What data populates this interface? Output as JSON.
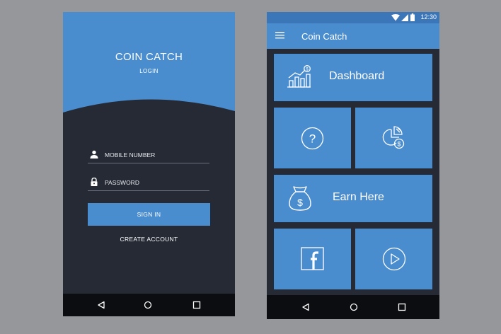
{
  "login_screen": {
    "app_title": "COIN CATCH",
    "subtitle": "LOGIN",
    "mobile_placeholder": "MOBILE NUMBER",
    "password_placeholder": "PASSWORD",
    "signin_label": "SIGN IN",
    "create_account_label": "CREATE ACCOUNT",
    "nav_icons": [
      "back-icon",
      "home-icon",
      "recents-icon"
    ]
  },
  "dashboard_screen": {
    "status_time": "12:30",
    "status_icons": [
      "wifi-icon",
      "signal-icon",
      "battery-icon"
    ],
    "app_title": "Coin Catch",
    "tiles": [
      {
        "label": "Dashboard",
        "icon": "chart-dollar-icon"
      },
      {
        "label": "",
        "icon": "help-icon"
      },
      {
        "label": "",
        "icon": "pie-dollar-icon"
      },
      {
        "label": "Earn Here",
        "icon": "money-bag-icon"
      },
      {
        "label": "",
        "icon": "facebook-icon"
      },
      {
        "label": "",
        "icon": "play-icon"
      }
    ],
    "nav_icons": [
      "back-icon",
      "home-icon",
      "recents-icon"
    ]
  },
  "colors": {
    "background": "#96979b",
    "primary_blue": "#4a8dcf",
    "status_blue": "#3b76b8",
    "dark_panel": "#252a35",
    "nav_black": "#0c0d10"
  }
}
